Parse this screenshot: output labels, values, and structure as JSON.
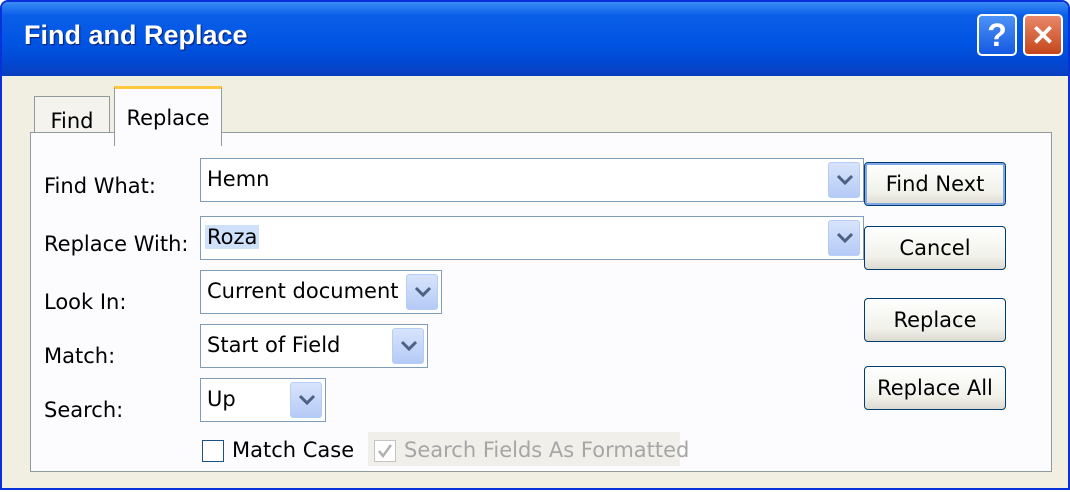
{
  "window": {
    "title": "Find and Replace",
    "help_label": "?",
    "close_label": "✕"
  },
  "tabs": [
    {
      "label": "Find"
    },
    {
      "label": "Replace"
    }
  ],
  "fields": {
    "find_what": {
      "label": "Find What:",
      "value": "Hemn"
    },
    "replace_with": {
      "label": "Replace With:",
      "value": "Roza"
    },
    "look_in": {
      "label": "Look In:",
      "value": "Current document"
    },
    "match": {
      "label": "Match:",
      "value": "Start of Field"
    },
    "search": {
      "label": "Search:",
      "value": "Up"
    }
  },
  "options": {
    "match_case": {
      "label": "Match Case",
      "checked": false
    },
    "search_fields_as_formatted": {
      "label": "Search Fields As Formatted",
      "checked": true,
      "enabled": false
    }
  },
  "buttons": {
    "find_next": "Find Next",
    "cancel": "Cancel",
    "replace": "Replace",
    "replace_all": "Replace All"
  },
  "colors": {
    "titlebar": "#0054e3",
    "dialog_bg": "#ece9d8",
    "tab_highlight": "#ffc83c"
  }
}
